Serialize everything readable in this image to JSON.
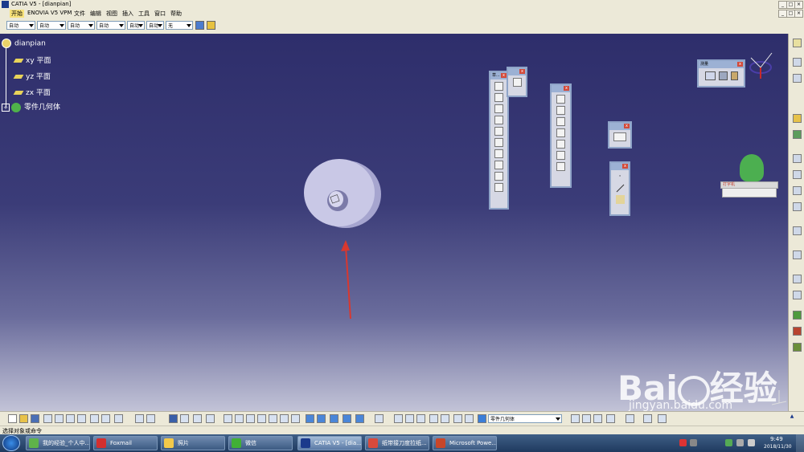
{
  "window": {
    "title": "CATIA V5 - [dianpian]"
  },
  "menu": {
    "items": [
      "开始",
      "ENOVIA V5 VPM",
      "文件",
      "编辑",
      "视图",
      "插入",
      "工具",
      "窗口",
      "帮助"
    ]
  },
  "style_toolbar": {
    "combos": [
      "自动",
      "自动",
      "自动",
      "自动",
      "自动",
      "自动",
      "无"
    ]
  },
  "tree": {
    "root": "dianpian",
    "planes": [
      "xy 平面",
      "yz 平面",
      "zx 平面"
    ],
    "body": "零件几何体"
  },
  "toolbars": {
    "measure_title": "测量",
    "sketcher_abbrev": "草...",
    "score_label": "打字机"
  },
  "bottom_toolbar": {
    "body_combo": "零件几何体"
  },
  "statusbar": {
    "text": "选择对象或命令"
  },
  "taskbar": {
    "tasks": [
      {
        "label": "我的经验_个人中...",
        "color": "#5fb34a"
      },
      {
        "label": "Foxmail",
        "color": "#d32f2f"
      },
      {
        "label": "照片",
        "color": "#f3c94a"
      },
      {
        "label": "微信",
        "color": "#41b035"
      },
      {
        "label": "CATIA V5 - [dia...",
        "color": "#1b3a8c",
        "active": true
      },
      {
        "label": "纸带接刀度拉纸...",
        "color": "#d84a3c"
      },
      {
        "label": "Microsoft Powe...",
        "color": "#c8462a"
      }
    ],
    "time": "9:49",
    "date": "2018/11/30"
  },
  "watermark": {
    "brand": "Bai",
    "brand2": "经验",
    "url": "jingyan.baidu.com"
  },
  "colors": {
    "viewport_top": "#2e2e6b",
    "part": "#c9c8e6",
    "arrow": "#d9382f",
    "tree_text": "#ffffff"
  }
}
